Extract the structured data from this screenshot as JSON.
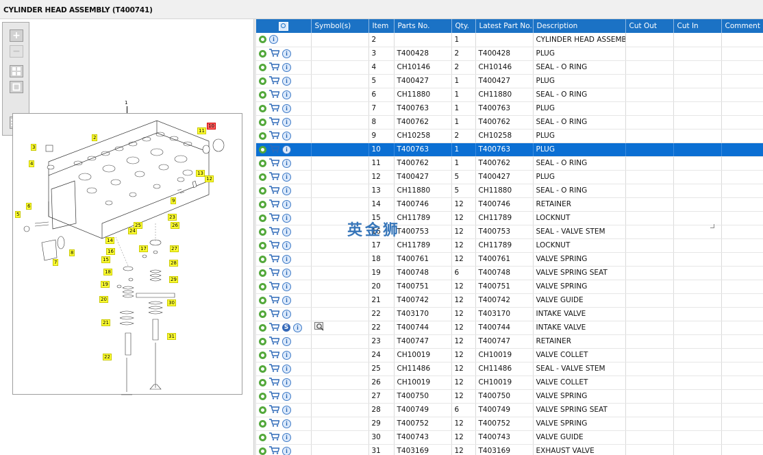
{
  "title": "CYLINDER HEAD ASSEMBLY (T400741)",
  "watermark": "英金狮",
  "colors": {
    "header_bg": "#1b72c5",
    "selected_row": "#0b6fd3",
    "callout": "#ffff33",
    "callout_highlight": "#ff6060"
  },
  "toolbar": {
    "zoom_in_icon": "plus-icon",
    "zoom_out_icon": "minus-icon",
    "fit_icon": "grid-icon",
    "frame_icon": "square-icon",
    "export_icon": "list-export-icon"
  },
  "drawing": {
    "assembly_label": "1",
    "callouts": [
      "2",
      "3",
      "4",
      "5",
      "6",
      "7",
      "8",
      "9",
      "10",
      "11",
      "12",
      "13",
      "14",
      "15",
      "16",
      "17",
      "18",
      "19",
      "20",
      "21",
      "22",
      "23",
      "24",
      "25",
      "26",
      "27",
      "28",
      "29",
      "30",
      "31"
    ],
    "highlighted_callout": "10"
  },
  "grid": {
    "columns": [
      "",
      "Symbol(s)",
      "Item",
      "Parts No.",
      "Qty.",
      "Latest Part No.",
      "Description",
      "Cut Out",
      "Cut In",
      "Comment"
    ],
    "selected_item": "10",
    "rows": [
      {
        "icons": "gear,info",
        "symbol": "",
        "item": "2",
        "part": "",
        "qty": "1",
        "latest": "",
        "desc": "CYLINDER HEAD ASSEMBLY"
      },
      {
        "icons": "gear,cart,info",
        "symbol": "",
        "item": "3",
        "part": "T400428",
        "qty": "2",
        "latest": "T400428",
        "desc": "PLUG"
      },
      {
        "icons": "gear,cart,info",
        "symbol": "",
        "item": "4",
        "part": "CH10146",
        "qty": "2",
        "latest": "CH10146",
        "desc": "SEAL - O RING"
      },
      {
        "icons": "gear,cart,info",
        "symbol": "",
        "item": "5",
        "part": "T400427",
        "qty": "1",
        "latest": "T400427",
        "desc": "PLUG"
      },
      {
        "icons": "gear,cart,info",
        "symbol": "",
        "item": "6",
        "part": "CH11880",
        "qty": "1",
        "latest": "CH11880",
        "desc": "SEAL - O RING"
      },
      {
        "icons": "gear,cart,info",
        "symbol": "",
        "item": "7",
        "part": "T400763",
        "qty": "1",
        "latest": "T400763",
        "desc": "PLUG"
      },
      {
        "icons": "gear,cart,info",
        "symbol": "",
        "item": "8",
        "part": "T400762",
        "qty": "1",
        "latest": "T400762",
        "desc": "SEAL - O RING"
      },
      {
        "icons": "gear,cart,info",
        "symbol": "",
        "item": "9",
        "part": "CH10258",
        "qty": "2",
        "latest": "CH10258",
        "desc": "PLUG"
      },
      {
        "icons": "gear,cart,info",
        "symbol": "",
        "item": "10",
        "part": "T400763",
        "qty": "1",
        "latest": "T400763",
        "desc": "PLUG"
      },
      {
        "icons": "gear,cart,info",
        "symbol": "",
        "item": "11",
        "part": "T400762",
        "qty": "1",
        "latest": "T400762",
        "desc": "SEAL - O RING"
      },
      {
        "icons": "gear,cart,info",
        "symbol": "",
        "item": "12",
        "part": "T400427",
        "qty": "5",
        "latest": "T400427",
        "desc": "PLUG"
      },
      {
        "icons": "gear,cart,info",
        "symbol": "",
        "item": "13",
        "part": "CH11880",
        "qty": "5",
        "latest": "CH11880",
        "desc": "SEAL - O RING"
      },
      {
        "icons": "gear,cart,info",
        "symbol": "",
        "item": "14",
        "part": "T400746",
        "qty": "12",
        "latest": "T400746",
        "desc": "RETAINER"
      },
      {
        "icons": "gear,cart,info",
        "symbol": "",
        "item": "15",
        "part": "CH11789",
        "qty": "12",
        "latest": "CH11789",
        "desc": "LOCKNUT"
      },
      {
        "icons": "gear,cart,info",
        "symbol": "",
        "item": "16",
        "part": "T400753",
        "qty": "12",
        "latest": "T400753",
        "desc": "SEAL - VALVE STEM"
      },
      {
        "icons": "gear,cart,info",
        "symbol": "",
        "item": "17",
        "part": "CH11789",
        "qty": "12",
        "latest": "CH11789",
        "desc": "LOCKNUT"
      },
      {
        "icons": "gear,cart,info",
        "symbol": "",
        "item": "18",
        "part": "T400761",
        "qty": "12",
        "latest": "T400761",
        "desc": "VALVE SPRING"
      },
      {
        "icons": "gear,cart,info",
        "symbol": "",
        "item": "19",
        "part": "T400748",
        "qty": "6",
        "latest": "T400748",
        "desc": "VALVE SPRING SEAT"
      },
      {
        "icons": "gear,cart,info",
        "symbol": "",
        "item": "20",
        "part": "T400751",
        "qty": "12",
        "latest": "T400751",
        "desc": "VALVE SPRING"
      },
      {
        "icons": "gear,cart,info",
        "symbol": "",
        "item": "21",
        "part": "T400742",
        "qty": "12",
        "latest": "T400742",
        "desc": "VALVE GUIDE"
      },
      {
        "icons": "gear,cart,info",
        "symbol": "",
        "item": "22",
        "part": "T403170",
        "qty": "12",
        "latest": "T403170",
        "desc": "INTAKE VALVE"
      },
      {
        "icons": "gear,cart,s,info",
        "symbol": "view",
        "item": "22",
        "part": "T400744",
        "qty": "12",
        "latest": "T400744",
        "desc": "INTAKE VALVE"
      },
      {
        "icons": "gear,cart,info",
        "symbol": "",
        "item": "23",
        "part": "T400747",
        "qty": "12",
        "latest": "T400747",
        "desc": "RETAINER"
      },
      {
        "icons": "gear,cart,info",
        "symbol": "",
        "item": "24",
        "part": "CH10019",
        "qty": "12",
        "latest": "CH10019",
        "desc": "VALVE COLLET"
      },
      {
        "icons": "gear,cart,info",
        "symbol": "",
        "item": "25",
        "part": "CH11486",
        "qty": "12",
        "latest": "CH11486",
        "desc": "SEAL - VALVE STEM"
      },
      {
        "icons": "gear,cart,info",
        "symbol": "",
        "item": "26",
        "part": "CH10019",
        "qty": "12",
        "latest": "CH10019",
        "desc": "VALVE COLLET"
      },
      {
        "icons": "gear,cart,info",
        "symbol": "",
        "item": "27",
        "part": "T400750",
        "qty": "12",
        "latest": "T400750",
        "desc": "VALVE SPRING"
      },
      {
        "icons": "gear,cart,info",
        "symbol": "",
        "item": "28",
        "part": "T400749",
        "qty": "6",
        "latest": "T400749",
        "desc": "VALVE SPRING SEAT"
      },
      {
        "icons": "gear,cart,info",
        "symbol": "",
        "item": "29",
        "part": "T400752",
        "qty": "12",
        "latest": "T400752",
        "desc": "VALVE SPRING"
      },
      {
        "icons": "gear,cart,info",
        "symbol": "",
        "item": "30",
        "part": "T400743",
        "qty": "12",
        "latest": "T400743",
        "desc": "VALVE GUIDE"
      },
      {
        "icons": "gear,cart,info",
        "symbol": "",
        "item": "31",
        "part": "T403169",
        "qty": "12",
        "latest": "T403169",
        "desc": "EXHAUST VALVE"
      }
    ]
  }
}
